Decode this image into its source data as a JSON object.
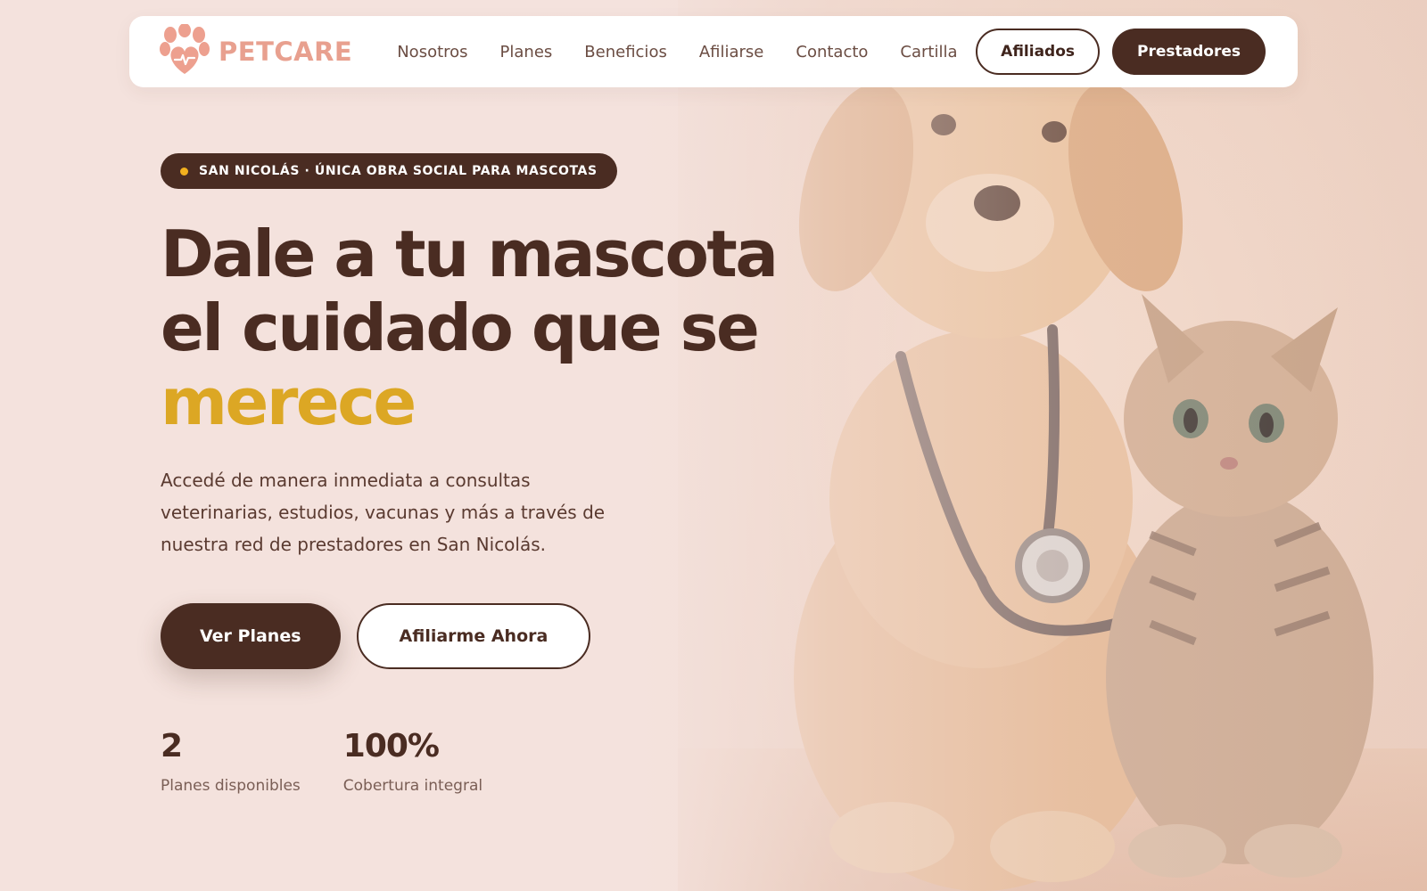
{
  "brand": {
    "name": "PETCARE",
    "logo_icon": "paw-heart-icon",
    "color": "#e8a08f"
  },
  "nav": {
    "links": [
      "Nosotros",
      "Planes",
      "Beneficios",
      "Afiliarse",
      "Contacto",
      "Cartilla"
    ],
    "afiliados_label": "Afiliados",
    "prestadores_label": "Prestadores"
  },
  "hero": {
    "badge": "SAN NICOLÁS · ÚNICA OBRA SOCIAL PARA MASCOTAS",
    "headline_line1": "Dale a tu mascota",
    "headline_line2": "el cuidado que se",
    "headline_accent": "merece",
    "lead": "Accedé de manera inmediata a consultas veterinarias, estudios, vacunas y más a través de nuestra red de prestadores en San Nicolás.",
    "primary_cta": "Ver Planes",
    "secondary_cta": "Afiliarme Ahora",
    "stats": [
      {
        "value": "2",
        "label": "Planes disponibles"
      },
      {
        "value": "100%",
        "label": "Cobertura integral"
      }
    ],
    "image": "puppy-and-kitten-with-stethoscope"
  },
  "colors": {
    "primary": "#4a2c22",
    "accent": "#dca724",
    "badge_dot": "#f2b01e",
    "background": "#f4e2dd"
  }
}
